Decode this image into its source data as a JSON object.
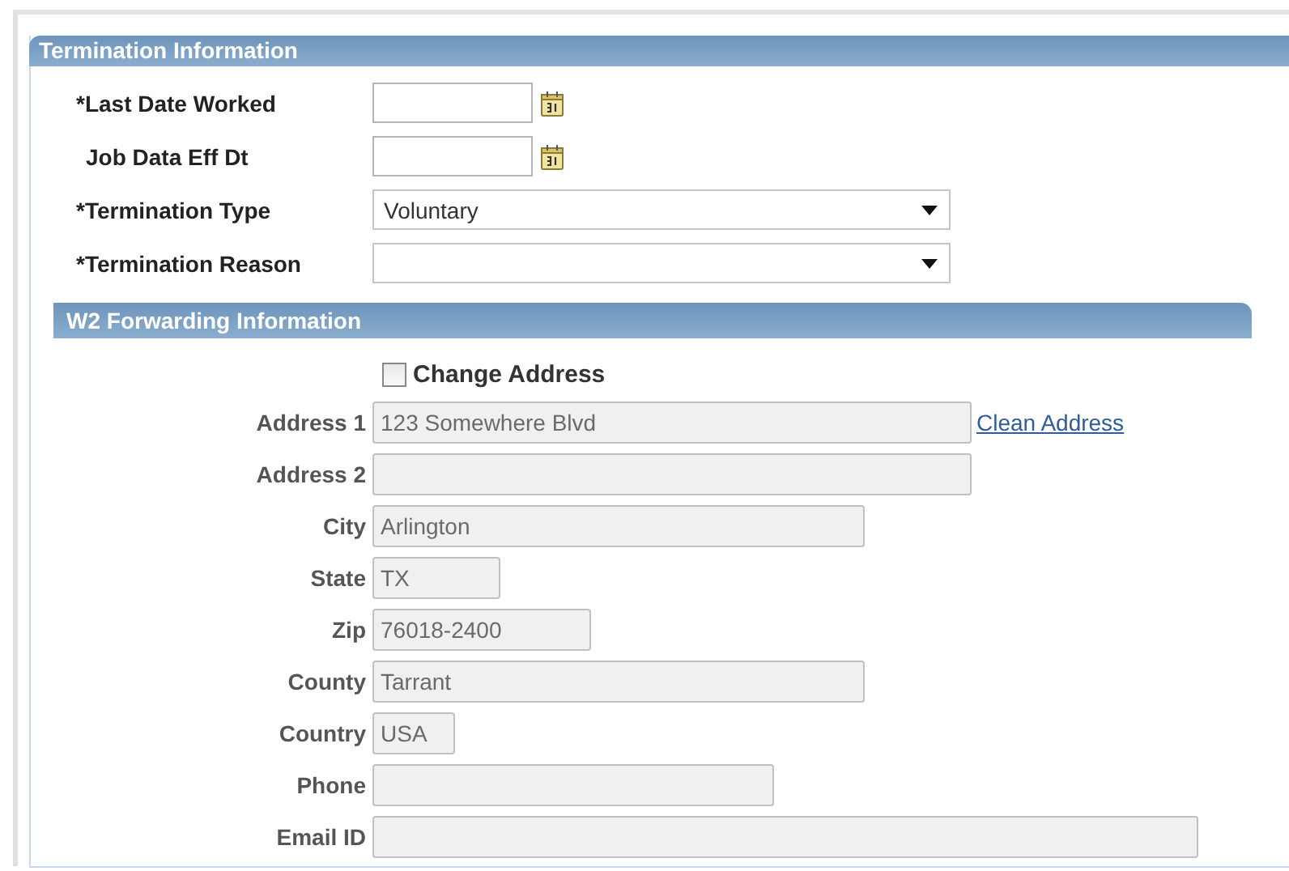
{
  "termination": {
    "title": "Termination Information",
    "fields": [
      {
        "label": "*Last Date Worked",
        "kind": "date",
        "required": true
      },
      {
        "label": "Job Data Eff Dt",
        "kind": "date",
        "required": false
      },
      {
        "label": "*Termination Type",
        "kind": "dropdown",
        "required": true,
        "value": "Voluntary"
      },
      {
        "label": "*Termination Reason",
        "kind": "dropdown",
        "required": true
      }
    ]
  },
  "w2": {
    "title": "W2 Forwarding Information",
    "change_address": {
      "label": "Change Address",
      "checked": false
    },
    "link": "Clean Address",
    "fields": [
      {
        "label": "Address 1",
        "value": "123 Somewhere Blvd",
        "disabled": true
      },
      {
        "label": "Address 2",
        "disabled": true
      },
      {
        "label": "City",
        "value": "Arlington",
        "disabled": true
      },
      {
        "label": "State",
        "value": "TX",
        "disabled": true
      },
      {
        "label": "Zip",
        "value": "76018-2400",
        "disabled": true
      },
      {
        "label": "County",
        "value": "Tarrant",
        "disabled": true
      },
      {
        "label": "Country",
        "value": "USA",
        "disabled": true
      },
      {
        "label": "Phone",
        "disabled": true
      },
      {
        "label": "Email ID",
        "disabled": true
      }
    ]
  }
}
